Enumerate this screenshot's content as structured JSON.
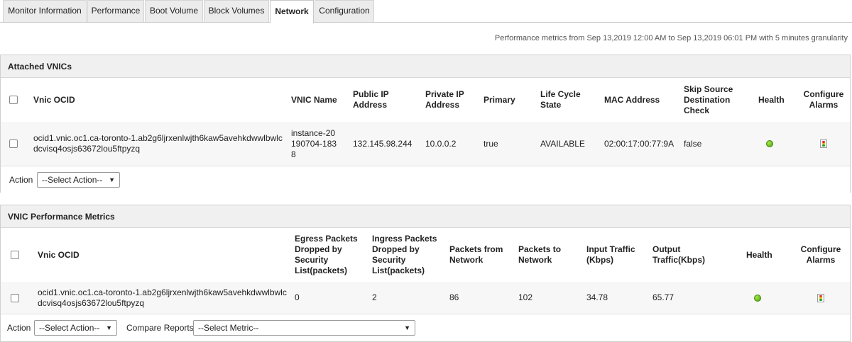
{
  "tabs": [
    {
      "label": "Monitor Information",
      "active": false
    },
    {
      "label": "Performance",
      "active": false
    },
    {
      "label": "Boot Volume",
      "active": false
    },
    {
      "label": "Block Volumes",
      "active": false
    },
    {
      "label": "Network",
      "active": true
    },
    {
      "label": "Configuration",
      "active": false
    }
  ],
  "perf_note": "Performance metrics from Sep 13,2019 12:00 AM to Sep 13,2019 06:01 PM with 5 minutes granularity",
  "vnics": {
    "title": "Attached VNICs",
    "headers": {
      "ocid": "Vnic OCID",
      "name": "VNIC Name",
      "public_ip": "Public IP Address",
      "private_ip": "Private IP Address",
      "primary": "Primary",
      "lifecycle": "Life Cycle State",
      "mac": "MAC Address",
      "skip_check": "Skip Source Destination Check",
      "health": "Health",
      "alarms": "Configure Alarms"
    },
    "row": {
      "ocid": "ocid1.vnic.oc1.ca-toronto-1.ab2g6ljrxenlwjth6kaw5avehkdwwlbwlcdcvisq4osjs63672lou5ftpyzq",
      "name": "instance-20190704-1838",
      "public_ip": "132.145.98.244",
      "private_ip": "10.0.0.2",
      "primary": "true",
      "lifecycle": "AVAILABLE",
      "mac": "02:00:17:00:77:9A",
      "skip_check": "false",
      "health_color": "#5cb814"
    },
    "action_label": "Action",
    "action_select": "--Select Action--"
  },
  "metrics": {
    "title": "VNIC Performance Metrics",
    "headers": {
      "ocid": "Vnic OCID",
      "egress": "Egress Packets Dropped by Security List(packets)",
      "ingress": "Ingress Packets Dropped by Security List(packets)",
      "pkts_from": "Packets from Network",
      "pkts_to": "Packets to Network",
      "input": "Input Traffic (Kbps)",
      "output": "Output Traffic(Kbps)",
      "health": "Health",
      "alarms": "Configure Alarms"
    },
    "row": {
      "ocid": "ocid1.vnic.oc1.ca-toronto-1.ab2g6ljrxenlwjth6kaw5avehkdwwlbwlcdcvisq4osjs63672lou5ftpyzq",
      "egress": "0",
      "ingress": "2",
      "pkts_from": "86",
      "pkts_to": "102",
      "input": "34.78",
      "output": "65.77",
      "health_color": "#5cb814"
    },
    "action_label": "Action",
    "action_select": "--Select Action--",
    "compare_label": "Compare Reports",
    "compare_select": "--Select Metric--"
  }
}
